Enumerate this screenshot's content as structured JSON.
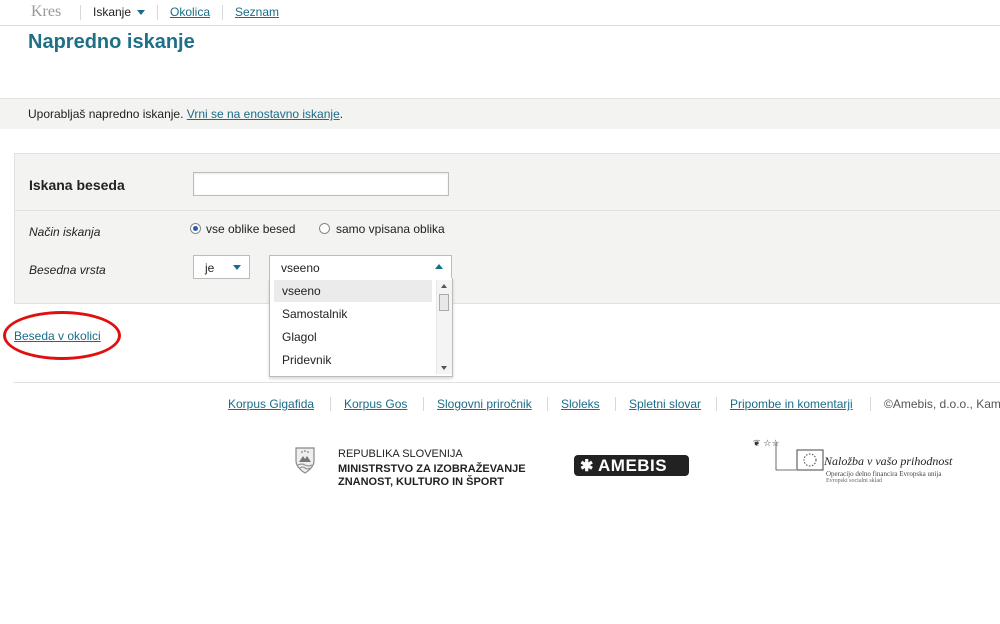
{
  "header": {
    "brand": "Kres",
    "nav": {
      "search": "Iskanje",
      "neighborhood": "Okolica",
      "list": "Seznam"
    }
  },
  "page": {
    "title": "Napredno iskanje",
    "info_text": "Uporabljaš napredno iskanje. ",
    "info_link": "Vrni se na enostavno iskanje",
    "info_after": "."
  },
  "form": {
    "word_label": "Iskana beseda",
    "word_value": "",
    "mode_label": "Način iskanja",
    "mode_options": [
      {
        "label": "vse oblike besed",
        "selected": true
      },
      {
        "label": "samo vpisana oblika",
        "selected": false
      }
    ],
    "pos_label": "Besedna vrsta",
    "pos_operator": "je",
    "pos_value": "vseeno",
    "pos_options": [
      "vseeno",
      "Samostalnik",
      "Glagol",
      "Pridevnik"
    ]
  },
  "neighbor_link": "Beseda v okolici",
  "footer": {
    "links": [
      "Korpus Gigafida",
      "Korpus Gos",
      "Slogovni priročnik",
      "Sloleks",
      "Spletni slovar",
      "Pripombe in komentarji"
    ],
    "copyright": "©Amebis, d.o.o., Kam",
    "gov_line1": "REPUBLIKA SLOVENIJA",
    "gov_line2": "MINISTRSTVO ZA IZOBRAŽEVANJE",
    "gov_line3": "ZNANOST, KULTURO IN ŠPORT",
    "amebis": "AMEBIS",
    "eu_main": "Naložba v vašo prihodnost",
    "eu_sub": "Operacijo delno financira Evropska unija",
    "eu_sub2": "Evropski socialni sklad"
  },
  "colors": {
    "accent": "#1f6f86",
    "link": "#1a6c8a",
    "annotation": "#e01010",
    "panel": "#f3f3f1"
  },
  "icons": [
    "chevron-down-icon",
    "radio-icon",
    "scroll-up-icon",
    "scroll-down-icon",
    "slovenia-coat-of-arms-icon",
    "eu-flag-icon"
  ]
}
